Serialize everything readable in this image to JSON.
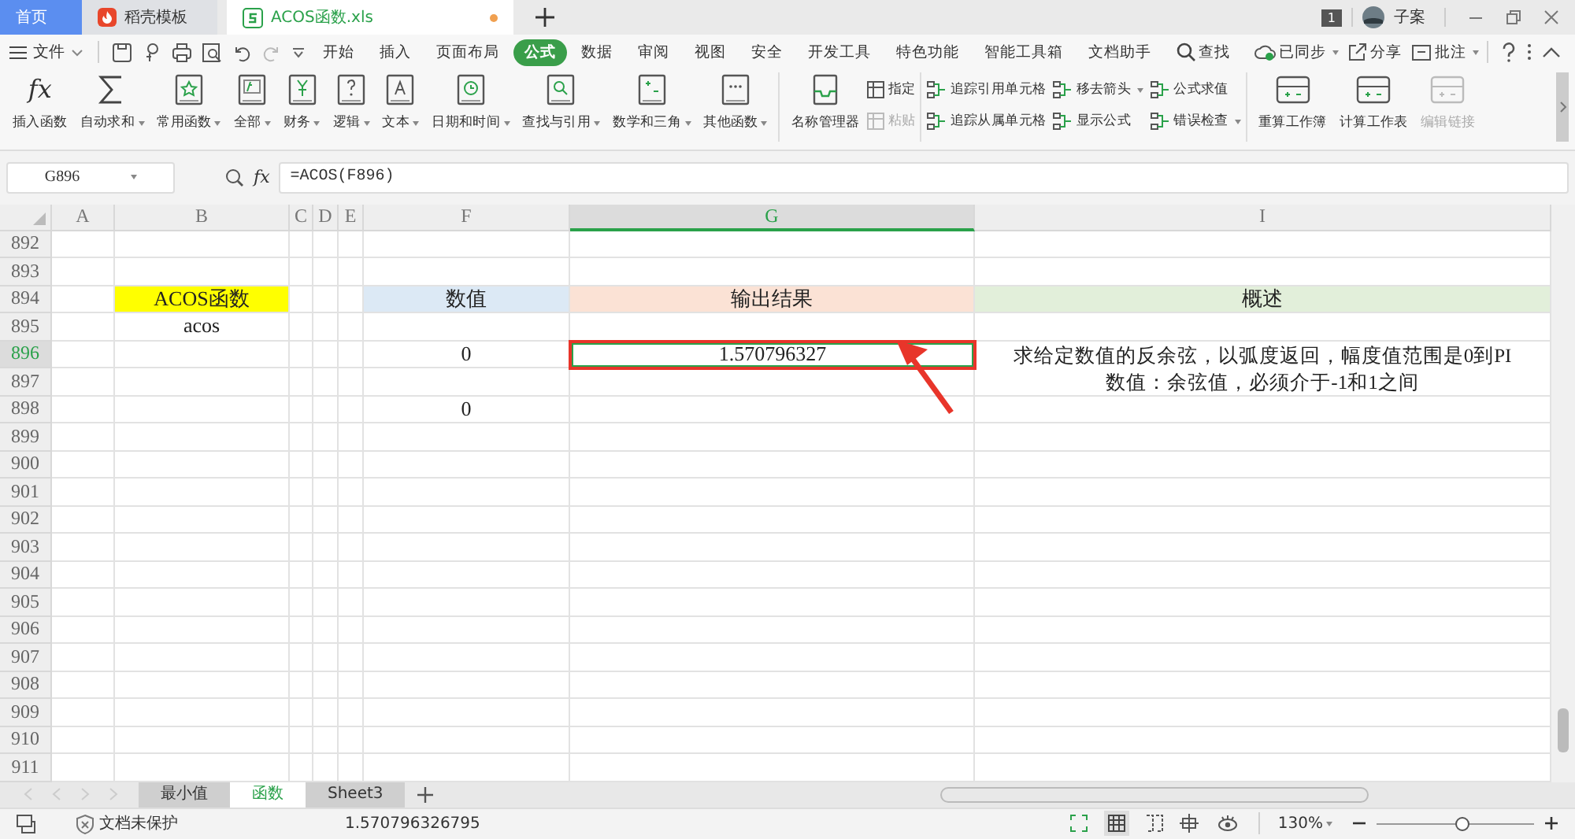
{
  "doc_tabs": [
    {
      "label": "首页",
      "kind": "home",
      "selected": false
    },
    {
      "label": "稻壳模板",
      "kind": "template",
      "selected": false
    },
    {
      "label": "ACOS函数.xls",
      "kind": "sheet",
      "selected": true,
      "modified": true
    }
  ],
  "window_badge": "1",
  "user": {
    "name": "子案"
  },
  "menu": {
    "file": "文件",
    "tabs": [
      {
        "label": "开始",
        "selected": false
      },
      {
        "label": "插入",
        "selected": false
      },
      {
        "label": "页面布局",
        "selected": false
      },
      {
        "label": "公式",
        "selected": true
      },
      {
        "label": "数据",
        "selected": false
      },
      {
        "label": "审阅",
        "selected": false
      },
      {
        "label": "视图",
        "selected": false
      },
      {
        "label": "安全",
        "selected": false
      },
      {
        "label": "开发工具",
        "selected": false
      },
      {
        "label": "特色功能",
        "selected": false
      },
      {
        "label": "智能工具箱",
        "selected": false
      },
      {
        "label": "文档助手",
        "selected": false
      }
    ],
    "search": "查找",
    "actions": [
      {
        "label": "已同步",
        "kind": "sync",
        "dropdown": true
      },
      {
        "label": "分享",
        "kind": "share",
        "dropdown": false
      },
      {
        "label": "批注",
        "kind": "comment",
        "dropdown": true
      }
    ]
  },
  "fx_symbol": "fx",
  "ribbon": {
    "functions": [
      {
        "label": "插入函数",
        "kind": "fx",
        "glyph": "fx",
        "dropdown": false
      },
      {
        "label": "自动求和",
        "kind": "sum",
        "dropdown": true
      },
      {
        "label": "常用函数",
        "kind": "star",
        "dropdown": true
      },
      {
        "label": "全部",
        "kind": "fxbook",
        "dropdown": true
      },
      {
        "label": "财务",
        "kind": "yen",
        "dropdown": true
      },
      {
        "label": "逻辑",
        "kind": "question",
        "dropdown": true
      },
      {
        "label": "文本",
        "kind": "letter",
        "dropdown": true
      },
      {
        "label": "日期和时间",
        "kind": "clock",
        "dropdown": true
      },
      {
        "label": "查找与引用",
        "kind": "lookup",
        "dropdown": true
      },
      {
        "label": "数学和三角",
        "kind": "math",
        "dropdown": true
      },
      {
        "label": "其他函数",
        "kind": "dots",
        "dropdown": true
      }
    ],
    "names": {
      "manager": "名称管理器",
      "small": [
        {
          "label": "指定",
          "disabled": false
        },
        {
          "label": "粘贴",
          "disabled": true
        }
      ]
    },
    "audit": [
      {
        "label": "追踪引用单元格",
        "dropdown": false
      },
      {
        "label": "追踪从属单元格",
        "dropdown": false
      },
      {
        "label": "移去箭头",
        "dropdown": true
      },
      {
        "label": "显示公式",
        "dropdown": false
      },
      {
        "label": "公式求值",
        "dropdown": false
      },
      {
        "label": "错误检查",
        "dropdown": true
      }
    ],
    "calc": [
      {
        "label": "重算工作簿",
        "disabled": false
      },
      {
        "label": "计算工作表",
        "disabled": false
      },
      {
        "label": "编辑链接",
        "disabled": true
      }
    ]
  },
  "name_box": "G896",
  "formula": "=ACOS(F896)",
  "columns": [
    {
      "label": "A",
      "selected": false
    },
    {
      "label": "B",
      "selected": false
    },
    {
      "label": "C",
      "selected": false
    },
    {
      "label": "D",
      "selected": false
    },
    {
      "label": "E",
      "selected": false
    },
    {
      "label": "F",
      "selected": false
    },
    {
      "label": "G",
      "selected": true
    },
    {
      "label": "I",
      "selected": false
    }
  ],
  "rows": [
    {
      "number": "892",
      "selected": false
    },
    {
      "number": "893",
      "selected": false
    },
    {
      "number": "894",
      "selected": false,
      "cells": [
        null,
        {
          "text": "ACOS函数",
          "color": "#ffff00",
          "selected": false
        },
        null,
        null,
        null,
        {
          "text": "数值",
          "color": "#dce9f5",
          "selected": false
        },
        {
          "text": "输出结果",
          "color": "#fbe2d5",
          "selected": false
        },
        {
          "text": "概述",
          "color": "#e2efda",
          "selected": false
        }
      ]
    },
    {
      "number": "895",
      "selected": false,
      "cells": [
        null,
        {
          "text": "acos",
          "selected": false
        },
        null,
        null,
        null,
        null,
        null,
        null
      ]
    },
    {
      "number": "896",
      "selected": true,
      "cells": [
        null,
        null,
        null,
        null,
        null,
        {
          "text": "0",
          "selected": false
        },
        {
          "text": "1.570796327",
          "selected": true
        },
        {
          "lines": [
            "求给定数值的反余弦，以弧度返回，幅度值范围是0到PI",
            "数值：余弦值，必须介于-1和1之间"
          ],
          "selected": false
        }
      ]
    },
    {
      "number": "897",
      "selected": false
    },
    {
      "number": "898",
      "selected": false,
      "cells": [
        null,
        null,
        null,
        null,
        null,
        {
          "text": "0",
          "selected": false
        },
        null,
        null
      ]
    },
    {
      "number": "899",
      "selected": false
    },
    {
      "number": "900",
      "selected": false
    },
    {
      "number": "901",
      "selected": false
    },
    {
      "number": "902",
      "selected": false
    },
    {
      "number": "903",
      "selected": false
    },
    {
      "number": "904",
      "selected": false
    },
    {
      "number": "905",
      "selected": false
    },
    {
      "number": "906",
      "selected": false
    },
    {
      "number": "907",
      "selected": false
    },
    {
      "number": "908",
      "selected": false
    },
    {
      "number": "909",
      "selected": false
    },
    {
      "number": "910",
      "selected": false
    },
    {
      "number": "911",
      "selected": false
    }
  ],
  "sheet_tabs": [
    {
      "label": "最小值",
      "selected": false
    },
    {
      "label": "函数",
      "selected": true
    },
    {
      "label": "Sheet3",
      "selected": false
    }
  ],
  "status_bar": {
    "protection": "文档未保护",
    "value": "1.570796326795",
    "zoom": "130%",
    "zoom_slider": {
      "level": 0.55
    }
  }
}
